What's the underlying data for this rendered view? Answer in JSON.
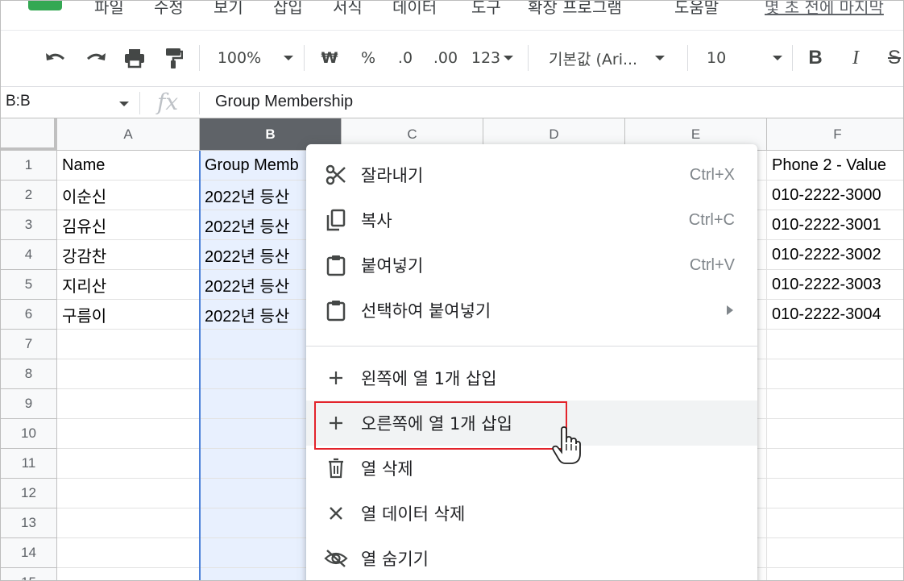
{
  "menubar": {
    "items": [
      "파일",
      "수정",
      "보기",
      "삽입",
      "서식",
      "데이터",
      "도구",
      "확장 프로그램",
      "도움말"
    ],
    "last_edit": "몇 초 전에 마지막"
  },
  "toolbar": {
    "zoom": "100%",
    "currency": "₩",
    "percent": "%",
    "decimal_decrease": ".0",
    "decimal_increase": ".00",
    "format_more": "123",
    "font": "기본값 (Ari...",
    "font_size": "10"
  },
  "formula_bar": {
    "name_box": "B:B",
    "fx": "fx",
    "value": "Group Membership"
  },
  "sheet": {
    "columns": [
      "A",
      "B",
      "C",
      "D",
      "E",
      "F"
    ],
    "selected_column": "B",
    "rows": [
      "1",
      "2",
      "3",
      "4",
      "5",
      "6",
      "7",
      "8",
      "9",
      "10",
      "11",
      "12",
      "13",
      "14",
      "15"
    ],
    "col_a": [
      "Name",
      "이순신",
      "김유신",
      "강감찬",
      "지리산",
      "구름이"
    ],
    "col_b": [
      "Group Memb",
      "2022년 등산",
      "2022년 등산",
      "2022년 등산",
      "2022년 등산",
      "2022년 등산"
    ],
    "col_f": [
      "Phone 2 - Value",
      "010-2222-3000",
      "010-2222-3001",
      "010-2222-3002",
      "010-2222-3003",
      "010-2222-3004"
    ]
  },
  "context_menu": {
    "cut": {
      "label": "잘라내기",
      "shortcut": "Ctrl+X"
    },
    "copy": {
      "label": "복사",
      "shortcut": "Ctrl+C"
    },
    "paste": {
      "label": "붙여넣기",
      "shortcut": "Ctrl+V"
    },
    "paste_special": {
      "label": "선택하여 붙여넣기"
    },
    "insert_left": {
      "label": "왼쪽에 열 1개 삽입"
    },
    "insert_right": {
      "label": "오른쪽에 열 1개 삽입"
    },
    "delete_column": {
      "label": "열 삭제"
    },
    "clear_column": {
      "label": "열 데이터 삭제"
    },
    "hide_column": {
      "label": "열 숨기기"
    }
  },
  "colors": {
    "selected_header": "#5f6368",
    "selection_fill": "#e8f0fe",
    "selection_border": "#4a7fd8",
    "highlight_box": "#e3232b",
    "app_logo": "#34a853"
  }
}
